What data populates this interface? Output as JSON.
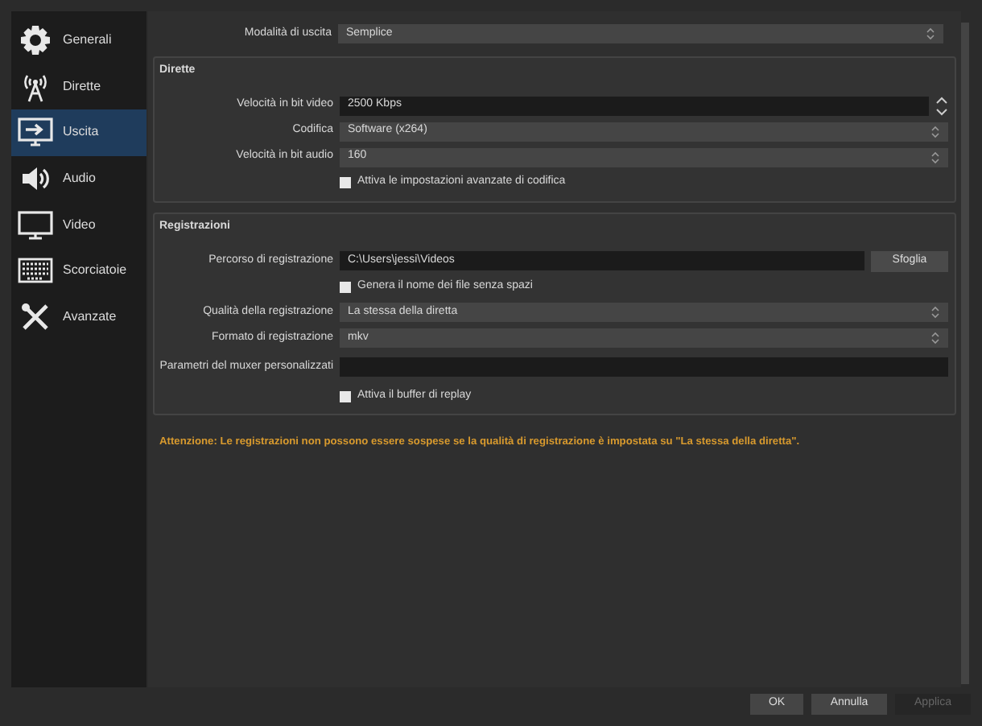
{
  "sidebar": {
    "items": [
      {
        "label": "Generali",
        "selected": false
      },
      {
        "label": "Dirette",
        "selected": false
      },
      {
        "label": "Uscita",
        "selected": true
      },
      {
        "label": "Audio",
        "selected": false
      },
      {
        "label": "Video",
        "selected": false
      },
      {
        "label": "Scorciatoie",
        "selected": false
      },
      {
        "label": "Avanzate",
        "selected": false
      }
    ]
  },
  "output_mode": {
    "label": "Modalità di uscita",
    "kind": "select",
    "value": "Semplice"
  },
  "groups": [
    {
      "title": "Dirette",
      "rows": [
        {
          "kind": "spin",
          "label": "Velocità in bit video",
          "value": "2500 Kbps"
        },
        {
          "kind": "select",
          "label": "Codifica",
          "value": "Software (x264)"
        },
        {
          "kind": "select",
          "label": "Velocità in bit audio",
          "value": "160"
        },
        {
          "kind": "checkbox",
          "label": "Attiva le impostazioni avanzate di codifica",
          "checked": false
        }
      ]
    },
    {
      "title": "Registrazioni",
      "rows": [
        {
          "kind": "path",
          "label": "Percorso di registrazione",
          "value": "C:\\Users\\jessi\\Videos",
          "button": "Sfoglia"
        },
        {
          "kind": "checkbox",
          "label": "Genera il nome dei file senza spazi",
          "checked": false
        },
        {
          "kind": "select",
          "label": "Qualità della registrazione",
          "value": "La stessa della diretta"
        },
        {
          "kind": "select",
          "label": "Formato di registrazione",
          "value": "mkv"
        },
        {
          "kind": "text",
          "label": "Parametri del muxer personalizzati",
          "value": ""
        },
        {
          "kind": "checkbox",
          "label": "Attiva il buffer di replay",
          "checked": false
        }
      ]
    }
  ],
  "warning": "Attenzione: Le registrazioni non possono essere sospese se la qualità di registrazione è impostata su \"La stessa della diretta\".",
  "buttons": [
    {
      "label": "OK",
      "disabled": false
    },
    {
      "label": "Annulla",
      "disabled": false
    },
    {
      "label": "Applica",
      "disabled": true
    }
  ]
}
